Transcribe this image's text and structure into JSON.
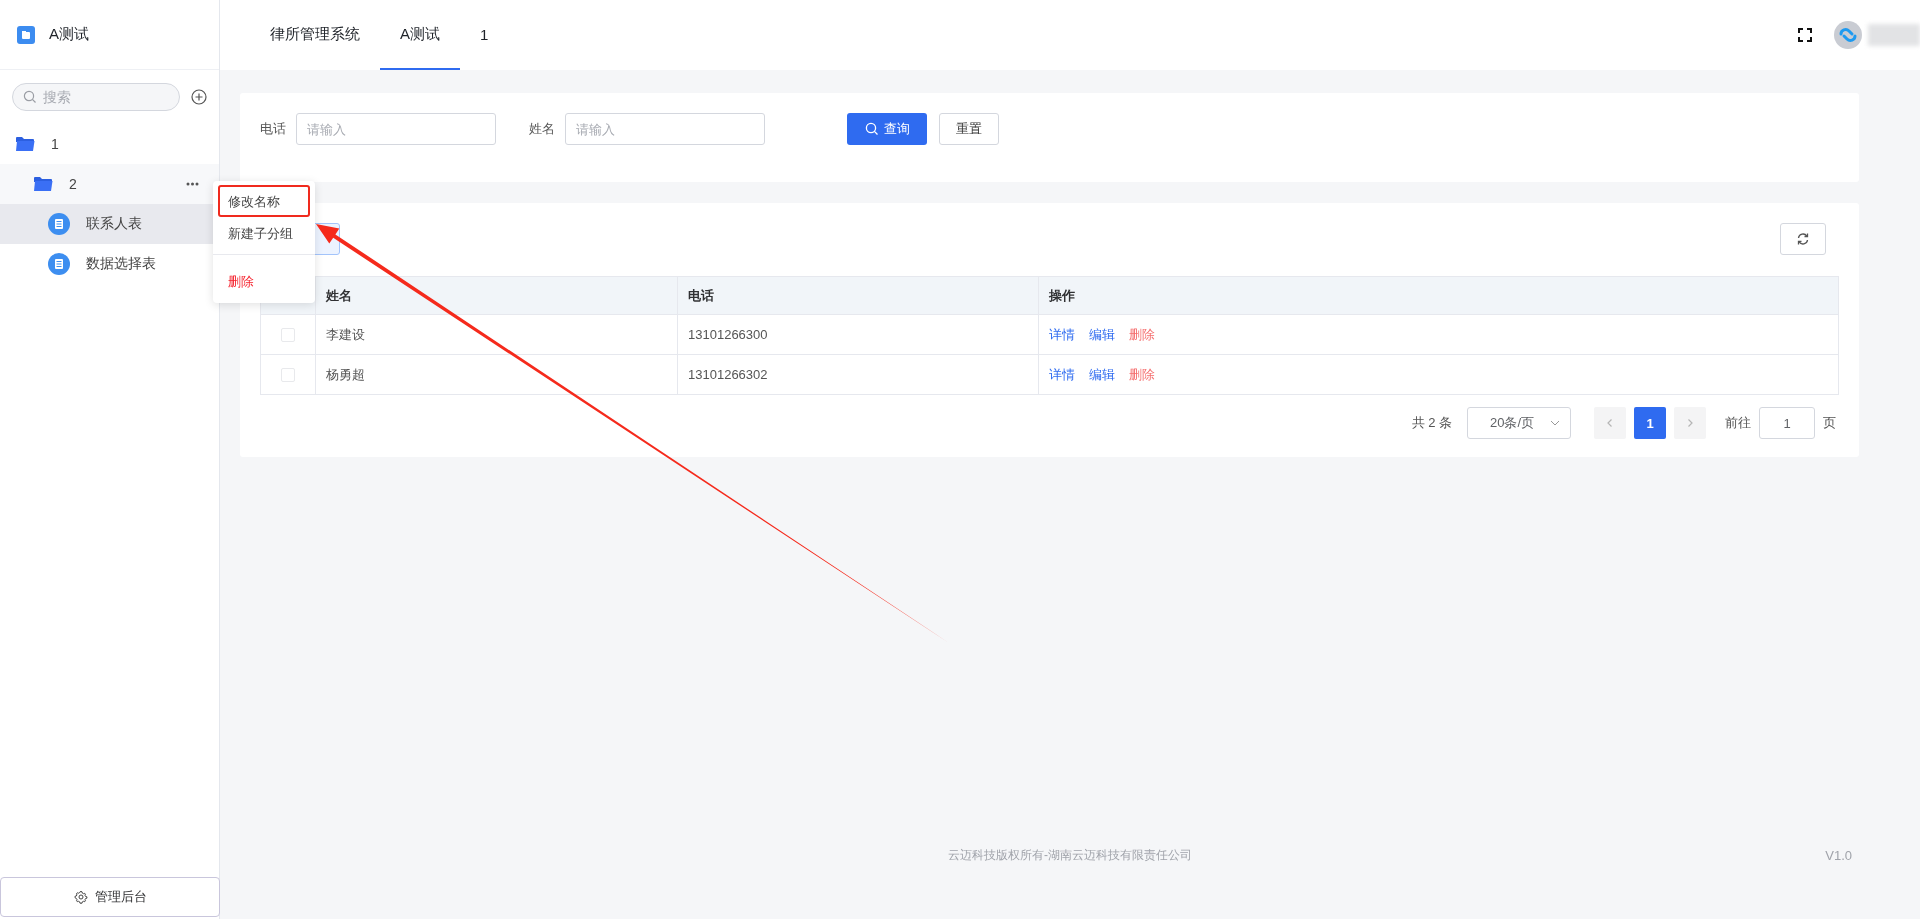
{
  "sidebar": {
    "title": "A测试",
    "search": {
      "placeholder": "搜索"
    },
    "tree": [
      {
        "label": "1",
        "kind": "folder",
        "selected": false,
        "menu_open": false,
        "children": [
          {
            "label": "2",
            "kind": "folder",
            "selected": false,
            "menu_open": true,
            "children": [
              {
                "label": "联系人表",
                "kind": "table",
                "selected": true,
                "menu_open": false
              },
              {
                "label": "数据选择表",
                "kind": "table",
                "selected": false,
                "menu_open": false
              }
            ]
          }
        ]
      }
    ],
    "admin_button": "管理后台"
  },
  "context_menu": {
    "items": [
      {
        "label": "修改名称",
        "kind": "normal",
        "annotated": true
      },
      {
        "label": "新建子分组",
        "kind": "normal",
        "annotated": false
      },
      {
        "label": "删除",
        "kind": "danger",
        "annotated": false
      }
    ]
  },
  "header": {
    "tabs": [
      {
        "label": "律所管理系统",
        "selected": false
      },
      {
        "label": "A测试",
        "selected": true
      },
      {
        "label": "1",
        "selected": false
      }
    ]
  },
  "filter": {
    "fields": [
      {
        "label": "电话",
        "placeholder": "请输入"
      },
      {
        "label": "姓名",
        "placeholder": "请输入"
      }
    ],
    "search_button": "查询",
    "reset_button": "重置"
  },
  "table": {
    "columns": [
      "姓名",
      "电话",
      "操作"
    ],
    "rows": [
      {
        "checked": false,
        "name": "李建设",
        "phone": "13101266300",
        "actions": [
          {
            "label": "详情",
            "kind": "link"
          },
          {
            "label": "编辑",
            "kind": "link"
          },
          {
            "label": "删除",
            "kind": "danger"
          }
        ]
      },
      {
        "checked": false,
        "name": "杨勇超",
        "phone": "13101266302",
        "actions": [
          {
            "label": "详情",
            "kind": "link"
          },
          {
            "label": "编辑",
            "kind": "link"
          },
          {
            "label": "删除",
            "kind": "danger"
          }
        ]
      }
    ]
  },
  "pagination": {
    "total": "共 2 条",
    "page_size": "20条/页",
    "prev": {
      "disabled": true
    },
    "pages": [
      {
        "label": "1",
        "selected": true
      }
    ],
    "next": {
      "disabled": true
    },
    "goto_label": "前往",
    "goto_value": "1",
    "goto_unit": "页"
  },
  "footer": {
    "copyright": "云迈科技版权所有-湖南云迈科技有限责任公司",
    "version": "V1.0"
  }
}
